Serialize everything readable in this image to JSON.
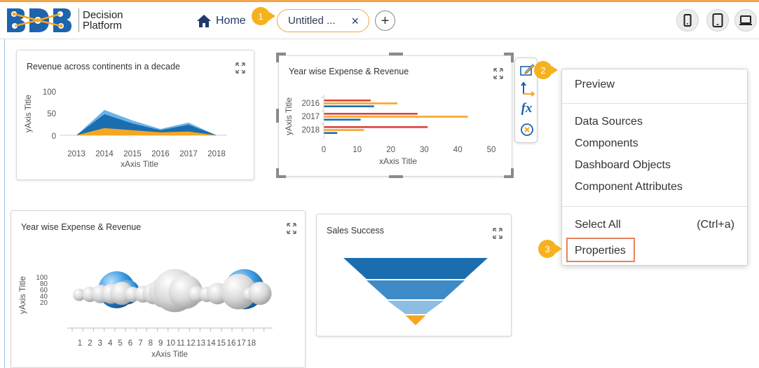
{
  "app": {
    "brand_line1": "Decision",
    "brand_line2": "Platform",
    "brand_accent": "#1d63ad"
  },
  "topbar": {
    "home_label": "Home",
    "home_icon": "home-icon",
    "tab_label": "Untitled ...",
    "tab_close": "×",
    "add_tab": "+",
    "device_icons": [
      "mobile-icon",
      "tablet-icon",
      "laptop-icon"
    ]
  },
  "callouts": [
    "1",
    "2",
    "3"
  ],
  "widgets": [
    {
      "title": "Revenue across continents in a decade",
      "xlabel": "xAxis Title",
      "ylabel": "yAxis Title",
      "chart_type": "area"
    },
    {
      "title": "Year wise Expense & Revenue",
      "xlabel": "xAxis Title",
      "ylabel": "yAxis Title",
      "chart_type": "bar"
    },
    {
      "title": "Year wise Expense & Revenue",
      "xlabel": "xAxis Title",
      "ylabel": "yAxis Title",
      "chart_type": "bubble"
    },
    {
      "title": "Sales Success",
      "chart_type": "funnel"
    }
  ],
  "chart_data": [
    {
      "type": "area",
      "title": "Revenue across continents in a decade",
      "xlabel": "xAxis Title",
      "ylabel": "yAxis Title",
      "categories": [
        "2013",
        "2014",
        "2015",
        "2016",
        "2017",
        "2018"
      ],
      "yticks": [
        "100",
        "50",
        "0"
      ],
      "ylim": [
        0,
        120
      ],
      "series": [
        {
          "color": "#6ab4e8",
          "values": [
            0,
            60,
            35,
            15,
            30,
            0
          ]
        },
        {
          "color": "#1a6eb0",
          "values": [
            0,
            50,
            28,
            12,
            25,
            0
          ]
        },
        {
          "color": "#f5a623",
          "values": [
            0,
            17,
            12,
            7,
            9,
            0
          ]
        }
      ]
    },
    {
      "type": "bar",
      "orientation": "horizontal",
      "title": "Year wise Expense & Revenue",
      "xlabel": "xAxis Title",
      "ylabel": "yAxis Title",
      "categories": [
        "2016",
        "2017",
        "2018"
      ],
      "xticks": [
        "0",
        "10",
        "20",
        "30",
        "40",
        "50"
      ],
      "xlim": [
        0,
        50
      ],
      "series": [
        {
          "color": "#d9433b",
          "values": [
            14,
            28,
            31
          ]
        },
        {
          "color": "#f5a623",
          "values": [
            22,
            43,
            12
          ]
        },
        {
          "color": "#1a6eb0",
          "values": [
            15,
            11,
            4
          ]
        }
      ]
    },
    {
      "type": "bubble",
      "title": "Year wise Expense & Revenue",
      "xlabel": "xAxis Title",
      "ylabel": "yAxis Title",
      "x_ticks": [
        "1",
        "2",
        "3",
        "4",
        "5",
        "6",
        "7",
        "8",
        "9",
        "10",
        "11",
        "12",
        "13",
        "14",
        "15",
        "16",
        "17",
        "18"
      ],
      "y_ticks": [
        "100",
        "80",
        "60",
        "40",
        "20"
      ],
      "series": [
        {
          "color": "#2e8fd6",
          "points": [
            [
              3,
              1.4
            ],
            [
              4,
              2.4
            ],
            [
              5,
              1.6
            ],
            [
              16,
              2.6
            ],
            [
              17,
              1.4
            ]
          ]
        },
        {
          "color": "#c8c8c8",
          "points": [
            [
              1,
              0.8
            ],
            [
              2,
              1.0
            ],
            [
              3,
              1.2
            ],
            [
              4,
              1.3
            ],
            [
              5,
              1.5
            ],
            [
              6,
              1.0
            ],
            [
              7,
              1.1
            ],
            [
              8,
              1.4
            ],
            [
              9,
              2.0
            ],
            [
              10,
              2.8
            ],
            [
              11,
              2.2
            ],
            [
              12,
              1.1
            ],
            [
              13,
              1.0
            ],
            [
              14,
              1.4
            ],
            [
              15,
              1.0
            ],
            [
              16,
              2.3
            ],
            [
              17,
              0.9
            ],
            [
              18,
              1.5
            ]
          ]
        }
      ]
    },
    {
      "type": "funnel",
      "title": "Sales Success",
      "series": [
        {
          "color": "#1a6eb0",
          "value": 100
        },
        {
          "color": "#3d8ac6",
          "value": 68
        },
        {
          "color": "#8dbde3",
          "value": 39
        },
        {
          "color": "#f5a623",
          "value": 14
        }
      ]
    }
  ],
  "side_toolbar": [
    "edit-chart-icon",
    "axis-icon",
    "fx-icon",
    "remove-icon"
  ],
  "side_toolbar_fx": "fx",
  "context_menu": {
    "preview": "Preview",
    "data_sources": "Data Sources",
    "components": "Components",
    "dashboard_objects": "Dashboard Objects",
    "component_attributes": "Component Attributes",
    "select_all": "Select All",
    "select_all_shortcut": "(Ctrl+a)",
    "properties": "Properties"
  },
  "colors": {
    "accent": "#f0a64a",
    "callout": "#f5b21e",
    "highlight": "#e8825a",
    "navy": "#1d3b6a"
  }
}
